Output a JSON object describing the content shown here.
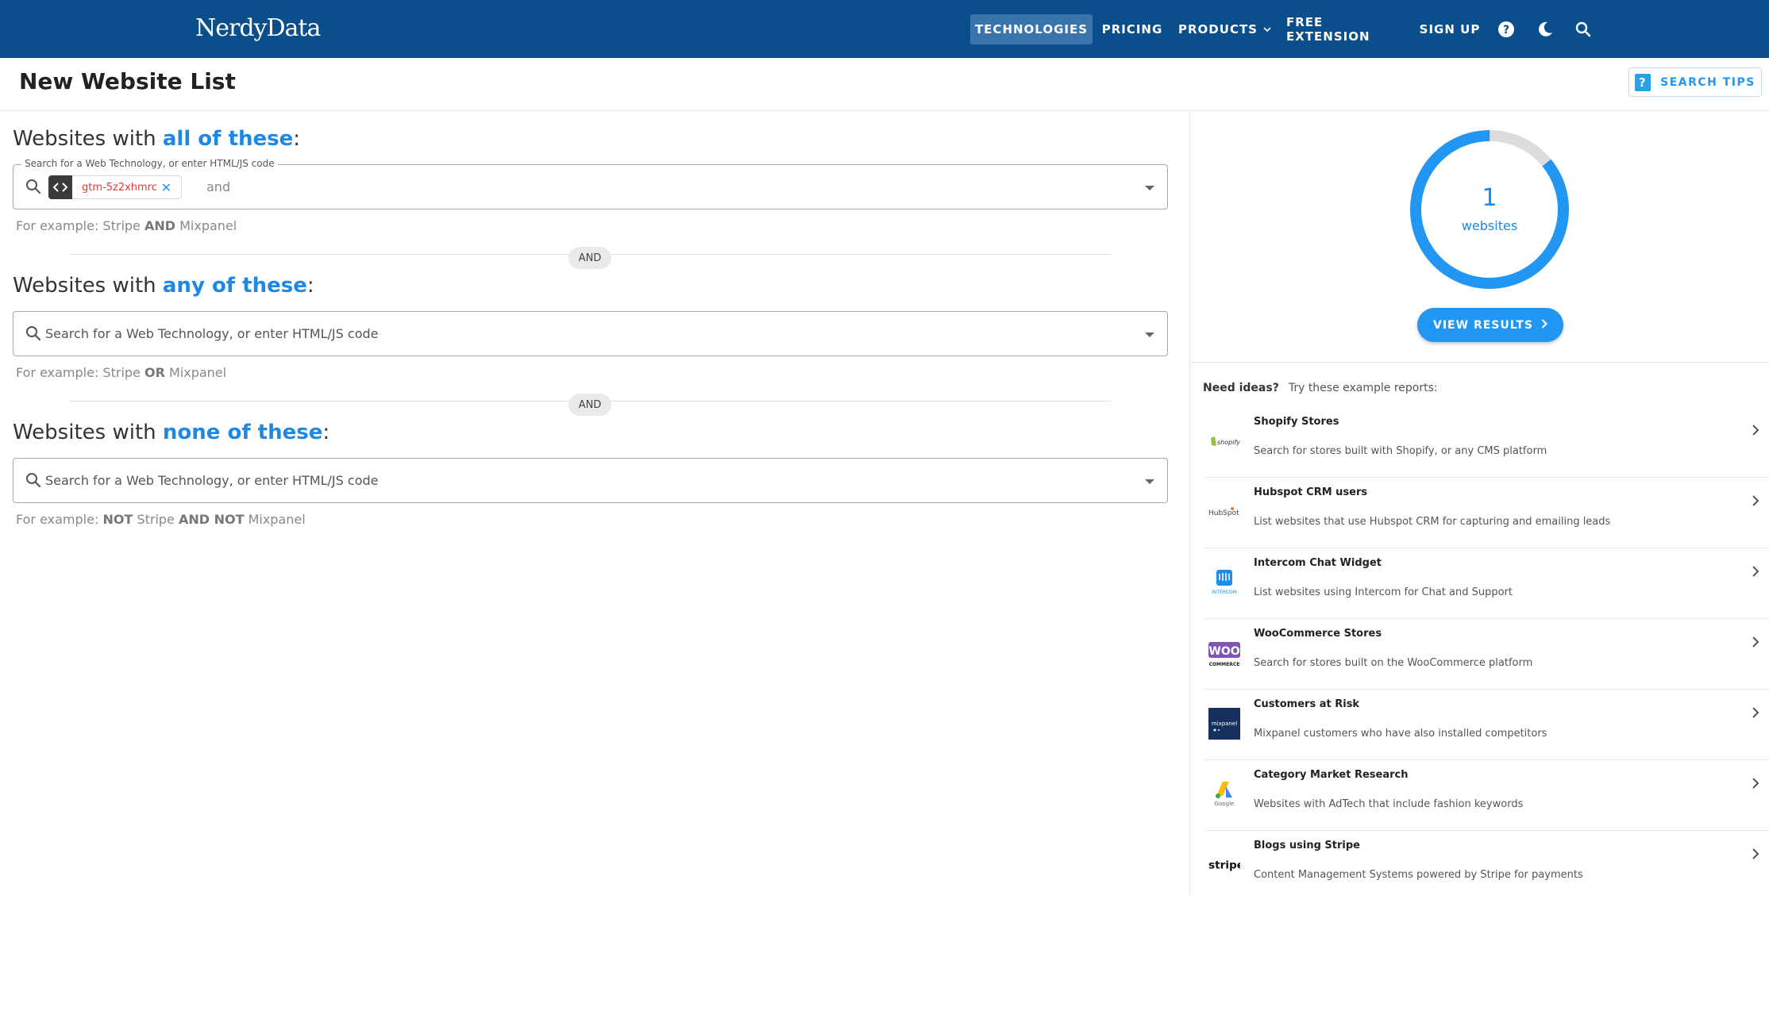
{
  "header": {
    "logo": "NerdyData",
    "nav": [
      {
        "label": "TECHNOLOGIES"
      },
      {
        "label": "PRICING"
      },
      {
        "label": "PRODUCTS"
      },
      {
        "label": "FREE EXTENSION"
      },
      {
        "label": "SIGN UP"
      }
    ],
    "products_chevron": "⌄"
  },
  "page": {
    "title": "New Website List",
    "search_tips": "SEARCH TIPS"
  },
  "query": {
    "all": {
      "prefix": "Websites with ",
      "emph": "all of these",
      "suffix": ":",
      "legend": "Search for a Web Technology, or enter HTML/JS code",
      "chip_value": "gtm-5z2xhmrc",
      "and_text": "and",
      "example_a": "For example: Stripe ",
      "example_op": "AND",
      "example_b": " Mixpanel"
    },
    "any": {
      "prefix": "Websites with ",
      "emph": "any of these",
      "suffix": ":",
      "placeholder": "Search for a Web Technology, or enter HTML/JS code",
      "example_a": "For example: Stripe ",
      "example_op": "OR",
      "example_b": " Mixpanel"
    },
    "none": {
      "prefix": "Websites with ",
      "emph": "none of these",
      "suffix": ":",
      "placeholder": "Search for a Web Technology, or enter HTML/JS code",
      "example_a": "For example: ",
      "example_op1": "NOT",
      "example_b": " Stripe ",
      "example_op2": "AND NOT",
      "example_c": " Mixpanel"
    },
    "and_pill": "AND"
  },
  "results": {
    "count": "1",
    "unit": "websites",
    "fill_fraction": 0.96,
    "button": "VIEW RESULTS"
  },
  "ideas": {
    "label": "Need ideas?",
    "sub": "Try these example reports:",
    "reports": [
      {
        "title": "Shopify Stores",
        "desc": "Search for stores built with Shopify, or any CMS platform",
        "logo": "shopify"
      },
      {
        "title": "Hubspot CRM users",
        "desc": "List websites that use Hubspot CRM for capturing and emailing leads",
        "logo": "HubSpot"
      },
      {
        "title": "Intercom Chat Widget",
        "desc": "List websites using Intercom for Chat and Support",
        "logo": "INTERCOM"
      },
      {
        "title": "WooCommerce Stores",
        "desc": "Search for stores built on the WooCommerce platform",
        "logo": "WOO"
      },
      {
        "title": "Customers at Risk",
        "desc": "Mixpanel customers who have also installed competitors",
        "logo": "mixpanel"
      },
      {
        "title": "Category Market Research",
        "desc": "Websites with AdTech that include fashion keywords",
        "logo": "Google"
      },
      {
        "title": "Blogs using Stripe",
        "desc": "Content Management Systems powered by Stripe for payments",
        "logo": "stripe"
      }
    ]
  },
  "colors": {
    "header_bg": "#0a4f8c",
    "accent": "#1e88e5",
    "chip_text": "#e53935"
  }
}
